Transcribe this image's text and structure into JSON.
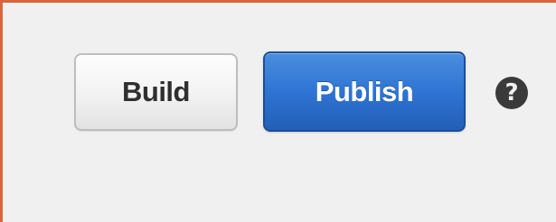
{
  "toolbar": {
    "build_label": "Build",
    "publish_label": "Publish",
    "help_glyph": "?"
  },
  "icons": {
    "help": "help-circle-icon"
  },
  "colors": {
    "frame_border": "#d9653c",
    "background": "#f0f0f0",
    "publish_primary": "#2f74d2",
    "build_text": "#2f2f2f"
  }
}
